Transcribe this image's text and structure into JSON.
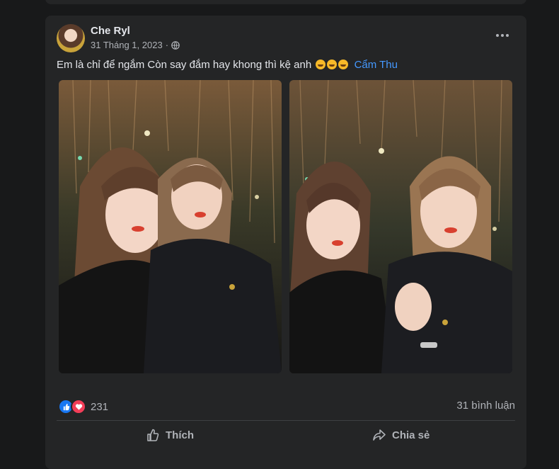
{
  "post": {
    "author": "Che Ryl",
    "date": "31 Tháng 1, 2023",
    "separator": "·",
    "privacy_icon": "globe-icon",
    "caption_text": "Em là chỉ để ngắm Còn say đắm hay khong thì kệ anh",
    "caption_emoji_icon": "grinning-squinting-face-icon",
    "tagged_name": "Cẩm Thu",
    "reaction_count": "231",
    "comment_count": "31 bình luận",
    "like_label": "Thích",
    "share_label": "Chia sẻ"
  },
  "colors": {
    "page_bg": "#18191a",
    "card_bg": "#242526",
    "link": "#4599ff",
    "like_blue": "#1877f2",
    "love_red": "#f33e58"
  }
}
